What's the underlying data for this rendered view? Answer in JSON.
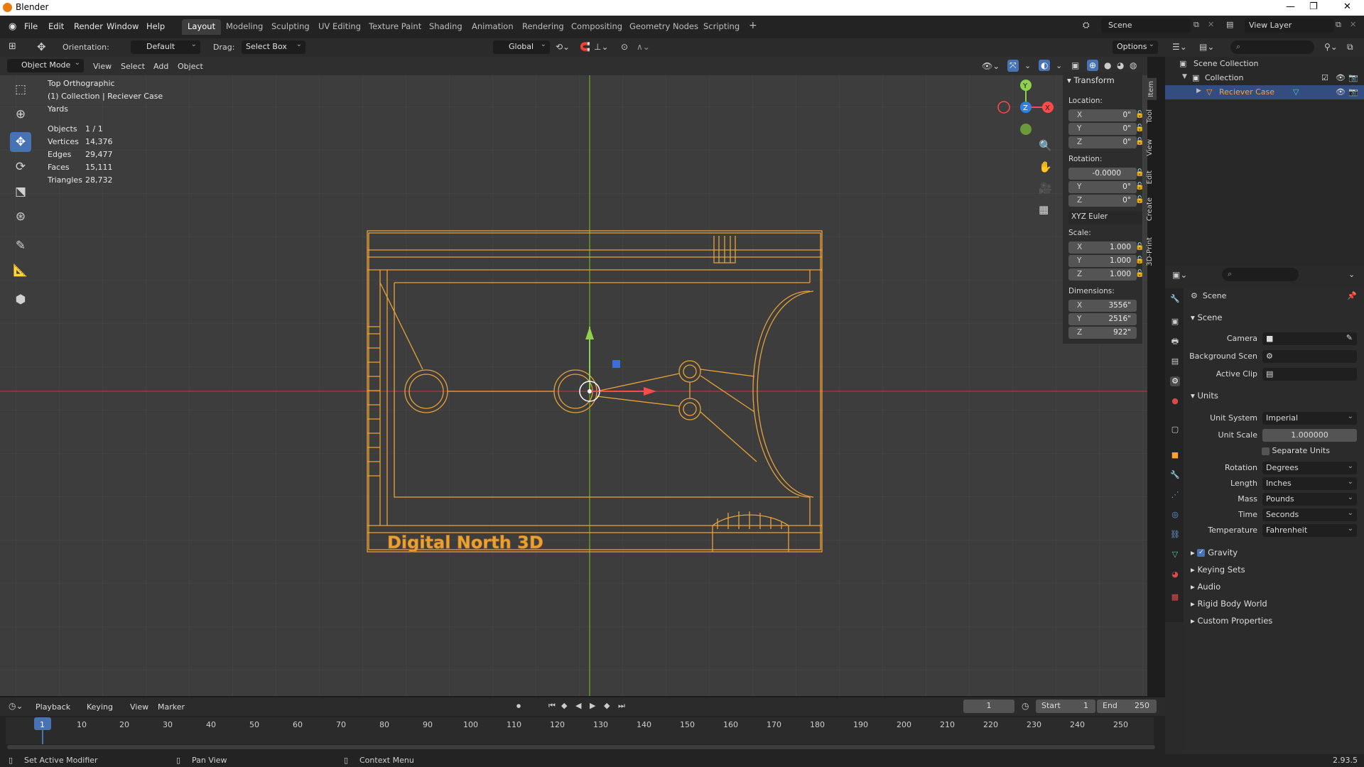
{
  "window": {
    "title": "Blender"
  },
  "menu": {
    "items": [
      "File",
      "Edit",
      "Render",
      "Window",
      "Help"
    ]
  },
  "workspaces": {
    "tabs": [
      "Layout",
      "Modeling",
      "Sculpting",
      "UV Editing",
      "Texture Paint",
      "Shading",
      "Animation",
      "Rendering",
      "Compositing",
      "Geometry Nodes",
      "Scripting"
    ],
    "active": "Layout",
    "add": "+"
  },
  "scene_selector": {
    "value": "Scene"
  },
  "view_layer": {
    "value": "View Layer"
  },
  "toolheader": {
    "orientation_label": "Orientation:",
    "orientation_value": "Default",
    "drag_label": "Drag:",
    "drag_value": "Select Box",
    "transform_orientation": "Global",
    "options": "Options"
  },
  "viewport_header": {
    "mode": "Object Mode",
    "menus": [
      "View",
      "Select",
      "Add",
      "Object"
    ]
  },
  "overlay": {
    "view_name": "Top Orthographic",
    "collection_line": "(1) Collection | Reciever Case",
    "units": "Yards",
    "stats": [
      {
        "label": "Objects",
        "value": "1 / 1"
      },
      {
        "label": "Vertices",
        "value": "14,376"
      },
      {
        "label": "Edges",
        "value": "29,477"
      },
      {
        "label": "Faces",
        "value": "15,111"
      },
      {
        "label": "Triangles",
        "value": "28,732"
      }
    ],
    "model_text": "Digital North 3D"
  },
  "gizmo": {
    "x": "X",
    "y": "Y",
    "z": "Z"
  },
  "npanel": {
    "title": "Transform",
    "location_label": "Location:",
    "location": [
      {
        "axis": "X",
        "value": "0\""
      },
      {
        "axis": "Y",
        "value": "0\""
      },
      {
        "axis": "Z",
        "value": "0\""
      }
    ],
    "rotation_label": "Rotation:",
    "rotation": [
      {
        "axis": "X",
        "value": "-0.0000"
      },
      {
        "axis": "Y",
        "value": "0°"
      },
      {
        "axis": "Z",
        "value": "0°"
      }
    ],
    "rotation_mode": "XYZ Euler",
    "scale_label": "Scale:",
    "scale": [
      {
        "axis": "X",
        "value": "1.000"
      },
      {
        "axis": "Y",
        "value": "1.000"
      },
      {
        "axis": "Z",
        "value": "1.000"
      }
    ],
    "dimensions_label": "Dimensions:",
    "dimensions": [
      {
        "axis": "X",
        "value": "3556\""
      },
      {
        "axis": "Y",
        "value": "2516\""
      },
      {
        "axis": "Z",
        "value": "922\""
      }
    ],
    "tabs": [
      "Item",
      "Tool",
      "View",
      "Edit",
      "Create",
      "3D-Print"
    ]
  },
  "outliner": {
    "root": "Scene Collection",
    "collection": "Collection",
    "object": "Reciever Case"
  },
  "properties": {
    "context": "Scene",
    "scene_section": "Scene",
    "camera_label": "Camera",
    "background_label": "Background Scen",
    "active_clip_label": "Active Clip",
    "units_section": "Units",
    "unit_system_label": "Unit System",
    "unit_system": "Imperial",
    "unit_scale_label": "Unit Scale",
    "unit_scale": "1.000000",
    "separate_units": "Separate Units",
    "rotation_label": "Rotation",
    "rotation": "Degrees",
    "length_label": "Length",
    "length": "Inches",
    "mass_label": "Mass",
    "mass": "Pounds",
    "time_label": "Time",
    "time": "Seconds",
    "temperature_label": "Temperature",
    "temperature": "Fahrenheit",
    "collapsed": [
      "Gravity",
      "Keying Sets",
      "Audio",
      "Rigid Body World",
      "Custom Properties"
    ]
  },
  "timeline": {
    "menus": [
      "Playback",
      "Keying",
      "View",
      "Marker"
    ],
    "current_frame": "1",
    "start_label": "Start",
    "start": "1",
    "end_label": "End",
    "end": "250",
    "ticks": [
      "1",
      "10",
      "20",
      "30",
      "40",
      "50",
      "60",
      "70",
      "80",
      "90",
      "100",
      "110",
      "120",
      "130",
      "140",
      "150",
      "160",
      "170",
      "180",
      "190",
      "200",
      "210",
      "220",
      "230",
      "240",
      "250"
    ]
  },
  "statusbar": {
    "left": "Set Active Modifier",
    "middle": "Pan View",
    "right": "Context Menu",
    "version": "2.93.5"
  },
  "colors": {
    "accent": "#4772b3",
    "wire": "#e8a23a",
    "axis_x": "#d44a4a",
    "axis_y": "#7fb33a",
    "selected": "#ffa033"
  }
}
